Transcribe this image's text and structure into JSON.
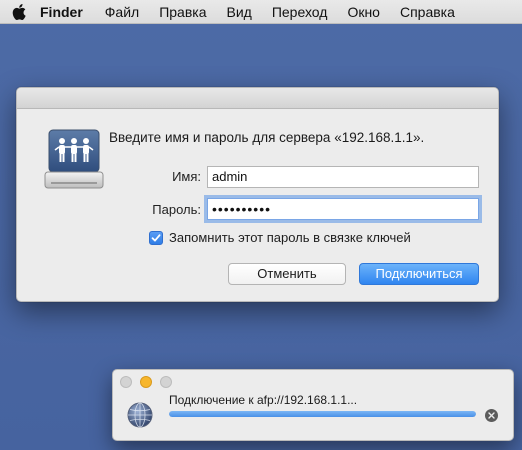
{
  "menubar": {
    "apple_icon": "apple-icon",
    "app_name": "Finder",
    "items": [
      "Файл",
      "Правка",
      "Вид",
      "Переход",
      "Окно",
      "Справка"
    ]
  },
  "auth_dialog": {
    "server_icon": "shared-server-icon",
    "prompt": "Введите имя и пароль для сервера «192.168.1.1».",
    "name_label": "Имя:",
    "name_value": "admin",
    "password_label": "Пароль:",
    "password_value": "••••••••••",
    "remember_label": "Запомнить этот пароль в связке ключей",
    "remember_checked": true,
    "cancel_label": "Отменить",
    "connect_label": "Подключиться",
    "accent_color": "#3a8ef3"
  },
  "progress_window": {
    "globe_icon": "network-globe-icon",
    "status_text": "Подключение к afp://192.168.1.1...",
    "progress_fraction": 1.0,
    "stop_icon": "stop-x-icon",
    "minimize_color": "#f7b62c"
  }
}
